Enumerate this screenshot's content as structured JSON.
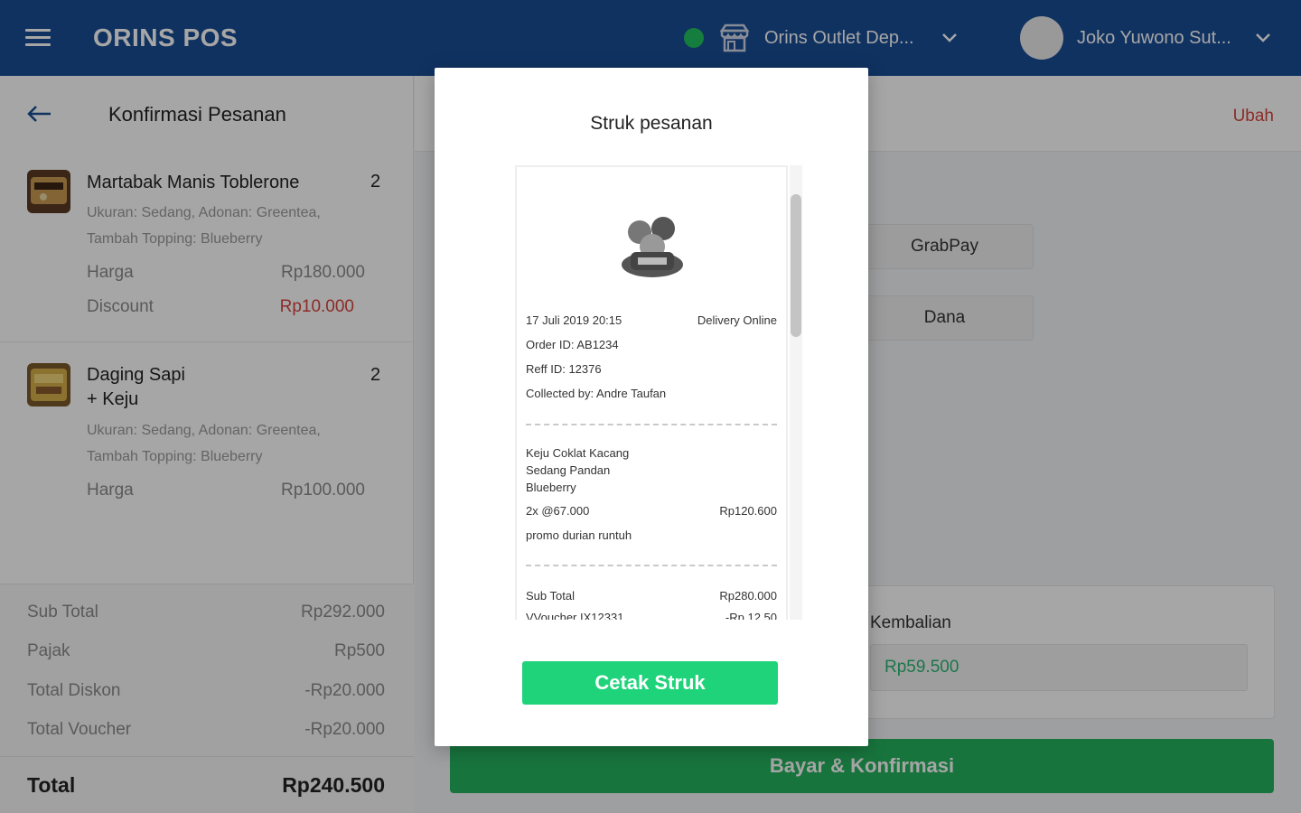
{
  "topbar": {
    "brand": "ORINS POS",
    "outlet": "Orins Outlet Dep...",
    "user": "Joko Yuwono Sut..."
  },
  "left": {
    "title": "Konfirmasi Pesanan",
    "items": [
      {
        "name": "Martabak Manis Toblerone",
        "qty": "2",
        "note1": "Ukuran: Sedang, Adonan: Greentea,",
        "note2": "Tambah Topping: Blueberry",
        "price_label": "Harga",
        "price": "Rp180.000",
        "discount_label": "Discount",
        "discount": "Rp10.000"
      },
      {
        "name1": "Daging Sapi",
        "name2": "+ Keju",
        "qty": "2",
        "note1": "Ukuran: Sedang, Adonan: Greentea,",
        "note2": "Tambah Topping: Blueberry",
        "price_label": "Harga",
        "price": "Rp100.000"
      }
    ],
    "summary": {
      "subtotal_label": "Sub Total",
      "subtotal": "Rp292.000",
      "tax_label": "Pajak",
      "tax": "Rp500",
      "discount_label": "Total Diskon",
      "discount": "-Rp20.000",
      "voucher_label": "Total Voucher",
      "voucher": "-Rp20.000",
      "total_label": "Total",
      "total": "Rp240.500"
    }
  },
  "right": {
    "edit_label": "Ubah",
    "payment_methods": [
      "GrabPay",
      "Dana"
    ],
    "change_label": "Kembalian",
    "change_value": "Rp59.500",
    "confirm_label": "Bayar & Konfirmasi"
  },
  "modal": {
    "title": "Struk pesanan",
    "receipt": {
      "datetime": "17 Juli 2019 20:15",
      "channel": "Delivery Online",
      "order_id": "Order ID: AB1234",
      "ref_id": "Reff ID: 12376",
      "collected_by": "Collected by: Andre Taufan",
      "item_line1": "Keju Coklat Kacang",
      "item_line2": "Sedang Pandan",
      "item_line3": "Blueberry",
      "item_qty_price": "2x   @67.000",
      "item_total": "Rp120.600",
      "promo": "promo durian runtuh",
      "subtotal_label": "Sub Total",
      "subtotal": "Rp280.000",
      "voucher_label": "VVoucher IX12331",
      "voucher": "-Rp 12.50"
    },
    "print_label": "Cetak Struk"
  },
  "colors": {
    "topbar": "#1a4d96",
    "status": "#21c05e",
    "discount_red": "#d9443e",
    "confirm_green": "#25b25f",
    "print_green": "#1fd37b"
  }
}
